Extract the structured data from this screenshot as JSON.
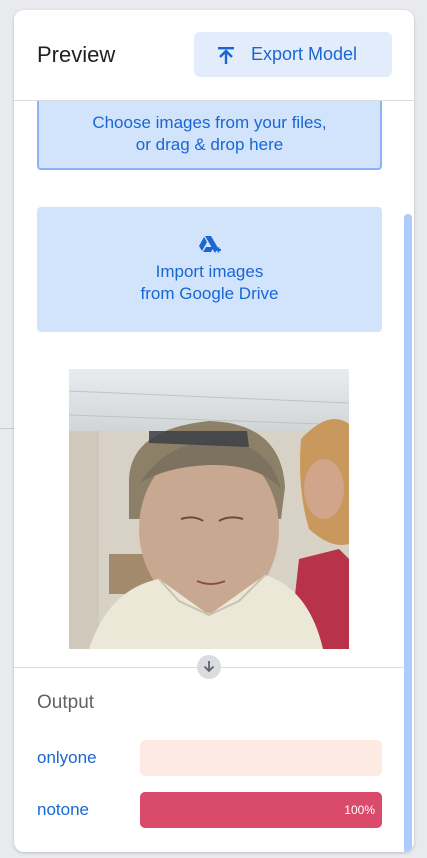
{
  "header": {
    "title": "Preview",
    "export_label": "Export Model",
    "export_icon": "upload-icon"
  },
  "upload": {
    "line1": "Choose images from your files,",
    "line2": "or drag & drop here"
  },
  "drive": {
    "icon": "google-drive-add-icon",
    "line1": "Import images",
    "line2": "from Google Drive"
  },
  "output": {
    "title": "Output",
    "classes": [
      {
        "label": "onlyone",
        "confidence": 0.0,
        "percent_text": "",
        "track_color": "#fdeae2",
        "fill_color": "#e8b8a6"
      },
      {
        "label": "notone",
        "confidence": 1.0,
        "percent_text": "100%",
        "track_color": "#f6c6cf",
        "fill_color": "#d94a6b"
      }
    ]
  },
  "colors": {
    "accent": "#1967d2",
    "button_bg": "#d2e3fc",
    "scrollbar": "#aecbfa"
  }
}
